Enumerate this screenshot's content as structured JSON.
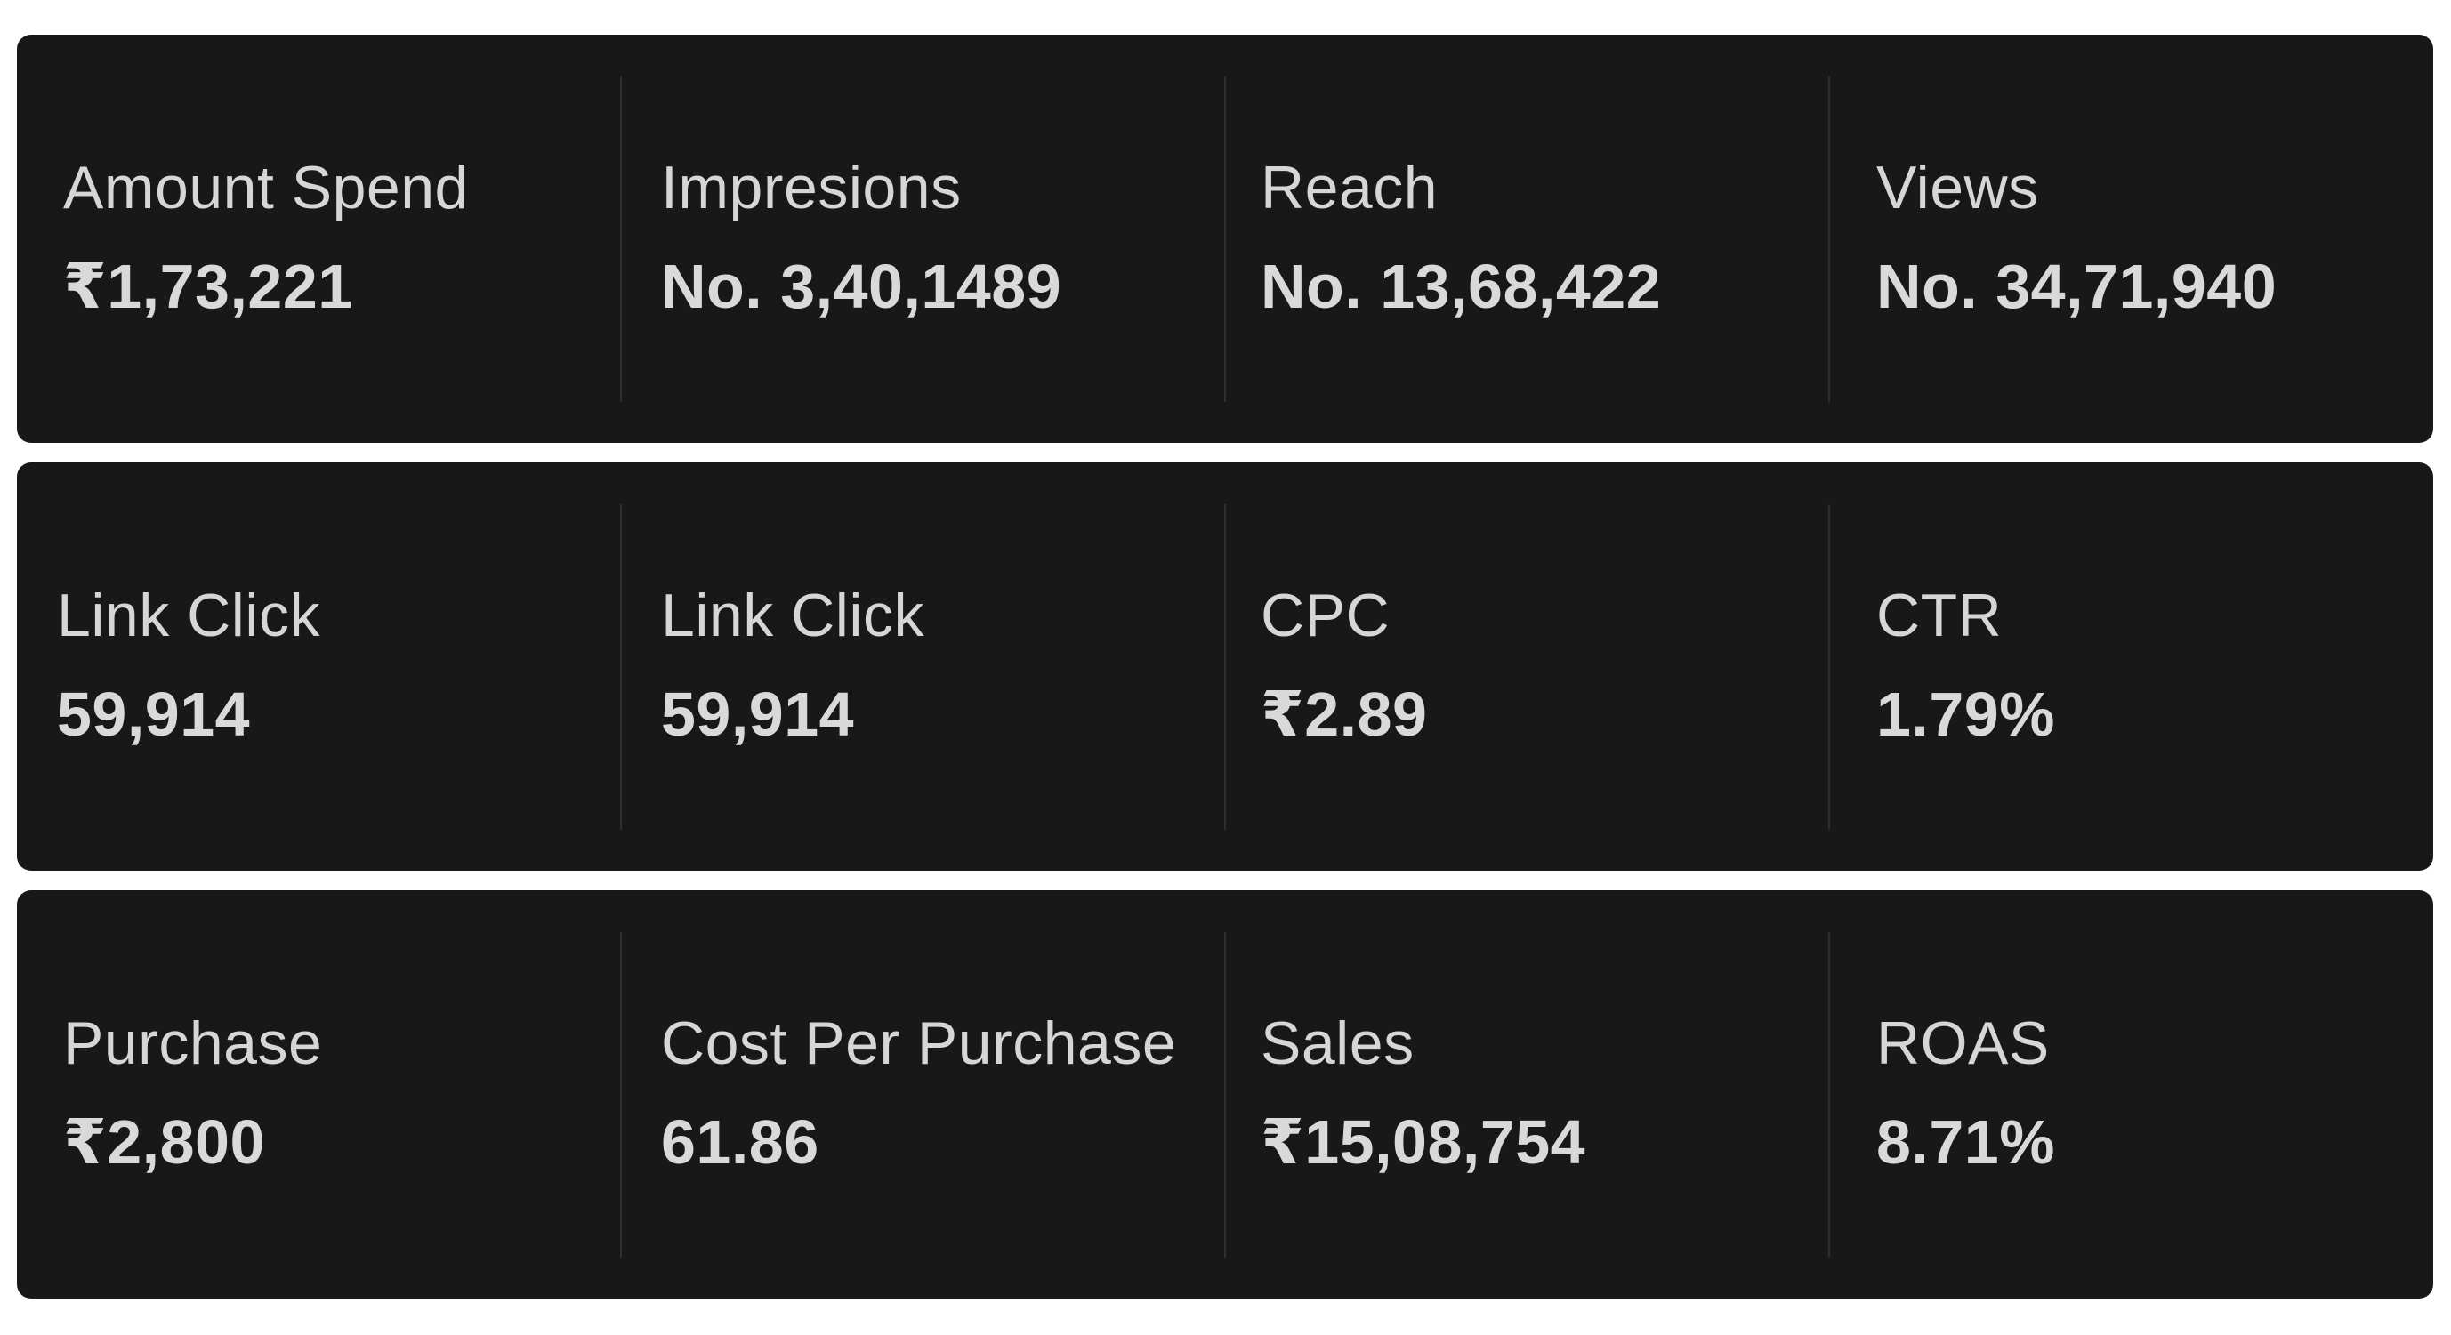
{
  "rows": [
    {
      "metrics": [
        {
          "label": "Amount Spend",
          "value": "₹1,73,221"
        },
        {
          "label": "Impresions",
          "value": "No. 3,40,1489"
        },
        {
          "label": "Reach",
          "value": "No. 13,68,422"
        },
        {
          "label": "Views",
          "value": "No. 34,71,940"
        }
      ]
    },
    {
      "metrics": [
        {
          "label": "Link Click",
          "value": "59,914"
        },
        {
          "label": "Link Click",
          "value": "59,914"
        },
        {
          "label": "CPC",
          "value": "₹2.89"
        },
        {
          "label": "CTR",
          "value": "1.79%"
        }
      ]
    },
    {
      "metrics": [
        {
          "label": "Purchase",
          "value": "₹2,800"
        },
        {
          "label": "Cost Per Purchase",
          "value": "61.86"
        },
        {
          "label": "Sales",
          "value": "₹15,08,754"
        },
        {
          "label": "ROAS",
          "value": "8.71%"
        }
      ]
    }
  ],
  "colors": {
    "page_background": "#ffffff",
    "card_background": "#181818",
    "label_text": "#d6d6d6",
    "value_text": "#d9d9d9",
    "divider": "#2e2e2e"
  }
}
